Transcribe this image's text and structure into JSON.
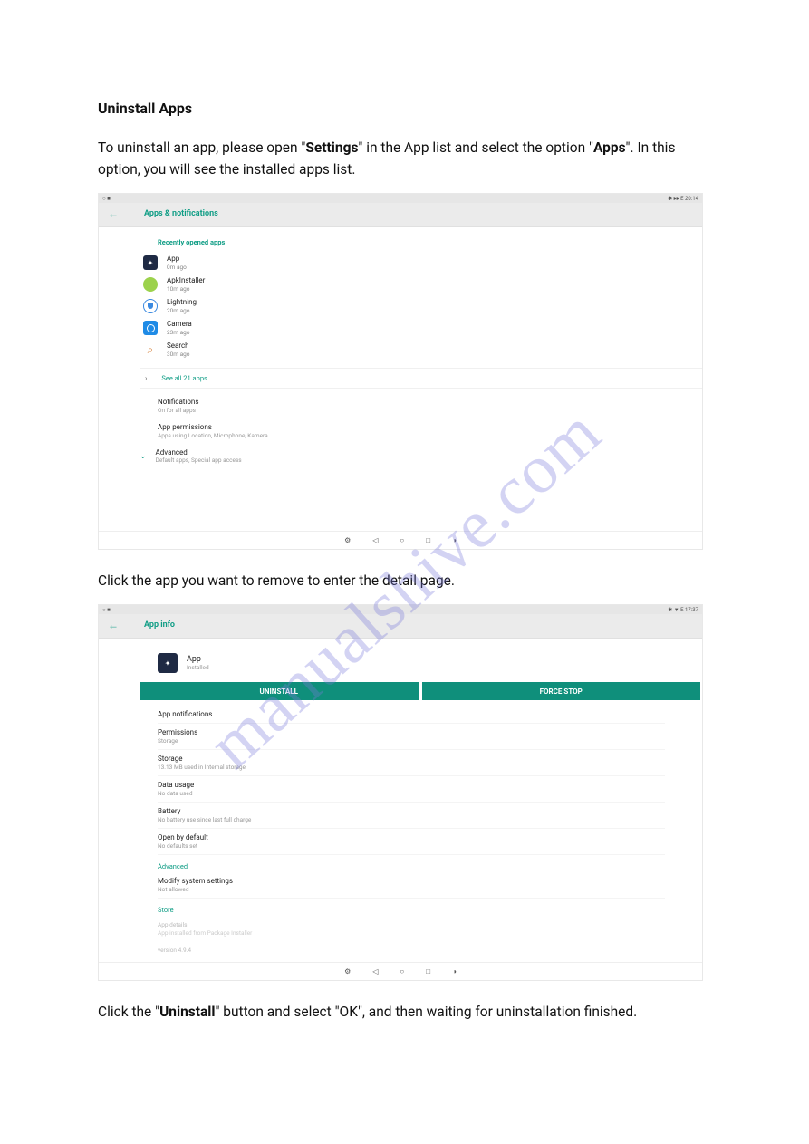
{
  "doc": {
    "title": "Uninstall Apps",
    "para1_a": "To uninstall an app, please open \"",
    "para1_b": "Settings",
    "para1_c": "\" in the App list and select the option \"",
    "para1_d": "Apps",
    "para1_e": "\". In this option, you will see the installed apps list.",
    "para2": "Click the app you want to remove to enter the detail page.",
    "para3_a": "Click the \"",
    "para3_b": "Uninstall",
    "para3_c": "\" button and select \"OK\", and then waiting for uninstallation finished."
  },
  "watermark": "manualshive.com",
  "shot1": {
    "status_left": "○  ■",
    "status_right": "✱  ▸▸  E   20:14",
    "back": "←",
    "headline": "Apps & notifications",
    "section": "Recently opened apps",
    "apps": [
      {
        "name": "App",
        "sub": "0m ago"
      },
      {
        "name": "ApkInstaller",
        "sub": "10m ago"
      },
      {
        "name": "Lightning",
        "sub": "20m ago"
      },
      {
        "name": "Camera",
        "sub": "23m ago"
      },
      {
        "name": "Search",
        "sub": "30m ago"
      }
    ],
    "see_all_chev": "›",
    "see_all": "See all 21 apps",
    "rows": [
      {
        "t": "Notifications",
        "s": "On for all apps"
      },
      {
        "t": "App permissions",
        "s": "Apps using Location, Microphone, Kamera"
      }
    ],
    "adv_chev": "⌄",
    "advanced": "Advanced",
    "advanced_sub": "Default apps, Special app access",
    "nav": [
      "⚙",
      "◁",
      "○",
      "□",
      "◑"
    ]
  },
  "shot2": {
    "status_left": "○  ■",
    "status_right": "✱ ▼ E   17:37",
    "back": "←",
    "headline": "App info",
    "app_name": "App",
    "app_sub": "Installed",
    "btn_uninstall": "UNINSTALL",
    "btn_forcestop": "FORCE STOP",
    "items": [
      {
        "t": "App notifications",
        "s": ""
      },
      {
        "t": "Permissions",
        "s": "Storage"
      },
      {
        "t": "Storage",
        "s": "13.13 MB used in Internal storage"
      },
      {
        "t": "Data usage",
        "s": "No data used"
      },
      {
        "t": "Battery",
        "s": "No battery use since last full charge"
      },
      {
        "t": "Open by default",
        "s": "No defaults set"
      }
    ],
    "advanced": "Advanced",
    "modify": "Modify system settings",
    "modify_sub": "Not allowed",
    "store": "Store",
    "store_r1": "App details",
    "store_r2": "App installed from Package Installer",
    "version": "version 4.9.4",
    "nav": [
      "⚙",
      "◁",
      "○",
      "□",
      "◑"
    ]
  }
}
